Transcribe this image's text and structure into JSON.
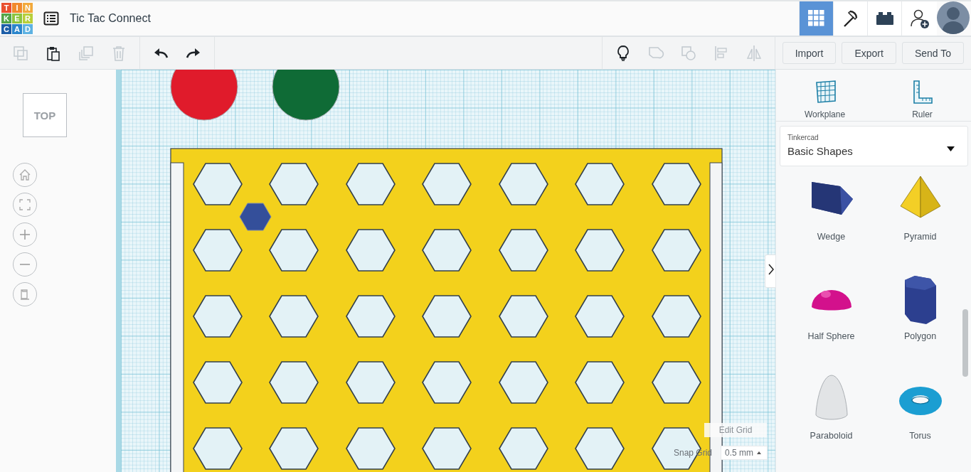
{
  "header": {
    "logo": [
      "T",
      "I",
      "N",
      "K",
      "E",
      "R",
      "C",
      "A",
      "D"
    ],
    "title": "Tic Tac Connect",
    "views": [
      {
        "kind": "grid",
        "selected": true
      },
      {
        "kind": "pickaxe",
        "selected": false
      },
      {
        "kind": "bricks",
        "selected": false
      }
    ]
  },
  "toolbar": {
    "edit_tools": [
      {
        "kind": "copy",
        "disabled": true
      },
      {
        "kind": "paste",
        "disabled": false
      },
      {
        "kind": "duplicate",
        "disabled": true
      },
      {
        "kind": "delete",
        "disabled": true
      }
    ],
    "history_tools": [
      {
        "kind": "undo",
        "disabled": false
      },
      {
        "kind": "redo",
        "disabled": false
      }
    ],
    "shape_tools": [
      {
        "kind": "bulb",
        "disabled": false
      },
      {
        "kind": "group",
        "disabled": true
      },
      {
        "kind": "ungroup",
        "disabled": true
      },
      {
        "kind": "align",
        "disabled": true
      },
      {
        "kind": "mirror",
        "disabled": true
      }
    ],
    "buttons": [
      "Import",
      "Export",
      "Send To"
    ]
  },
  "view_cube": {
    "label": "TOP"
  },
  "grid_controls": {
    "edit_button": "Edit Grid",
    "snap_label": "Snap Grid",
    "snap_value": "0.5 mm"
  },
  "panel": {
    "tools": [
      {
        "kind": "workplane",
        "label": "Workplane"
      },
      {
        "kind": "ruler",
        "label": "Ruler"
      }
    ],
    "library": {
      "source": "Tinkercad",
      "value": "Basic Shapes"
    },
    "shapes": [
      {
        "kind": "wedge",
        "label": "Wedge"
      },
      {
        "kind": "pyramid",
        "label": "Pyramid"
      },
      {
        "kind": "half_sphere",
        "label": "Half Sphere"
      },
      {
        "kind": "polygon",
        "label": "Polygon"
      },
      {
        "kind": "paraboloid",
        "label": "Paraboloid"
      },
      {
        "kind": "torus",
        "label": "Torus"
      }
    ]
  }
}
